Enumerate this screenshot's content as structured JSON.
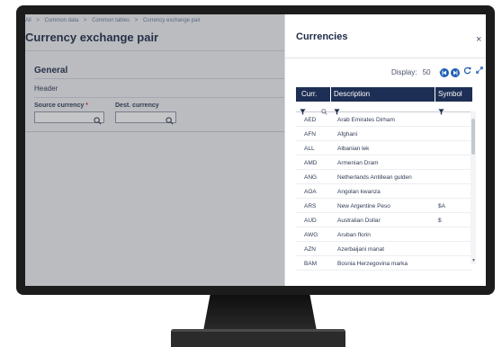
{
  "breadcrumb": [
    "All",
    "Common data",
    "Common tables",
    "Currency exchange pair"
  ],
  "breadcrumb_sep": ">",
  "page_title": "Currency exchange pair",
  "section": {
    "title": "General",
    "header_label": "Header"
  },
  "fields": {
    "source_label": "Source currency",
    "source_required": "*",
    "dest_label": "Dest. currency"
  },
  "panel": {
    "title": "Currencies",
    "close_glyph": "×",
    "display_label": "Display:",
    "display_value": "50",
    "caret": "▼"
  },
  "table": {
    "columns": [
      "Curr.",
      "Description",
      "Symbol"
    ],
    "rows": [
      {
        "code": "AED",
        "desc": "Arab Emirates Dirham",
        "sym": ""
      },
      {
        "code": "AFN",
        "desc": "Afghani",
        "sym": ""
      },
      {
        "code": "ALL",
        "desc": "Albanian lek",
        "sym": ""
      },
      {
        "code": "AMD",
        "desc": "Armenian Dram",
        "sym": ""
      },
      {
        "code": "ANG",
        "desc": "Netherlands Antillean gulden",
        "sym": ""
      },
      {
        "code": "AOA",
        "desc": "Angolan kwanza",
        "sym": ""
      },
      {
        "code": "ARS",
        "desc": "New Argentine Peso",
        "sym": "$A"
      },
      {
        "code": "AUD",
        "desc": "Australian Dollar",
        "sym": "$"
      },
      {
        "code": "AWG",
        "desc": "Aruban florin",
        "sym": ""
      },
      {
        "code": "AZN",
        "desc": "Azerbaijani manat",
        "sym": ""
      },
      {
        "code": "BAM",
        "desc": "Bosnia Herzegovina marka",
        "sym": ""
      }
    ]
  },
  "icons": {
    "filter": "filter-icon",
    "search": "search-icon",
    "first": "first-page-icon",
    "next": "next-page-icon",
    "refresh": "refresh-icon",
    "expand": "expand-icon"
  },
  "colors": {
    "accent": "#1f5fb6",
    "header_bg": "#1e2f55",
    "required": "#d9343f"
  }
}
